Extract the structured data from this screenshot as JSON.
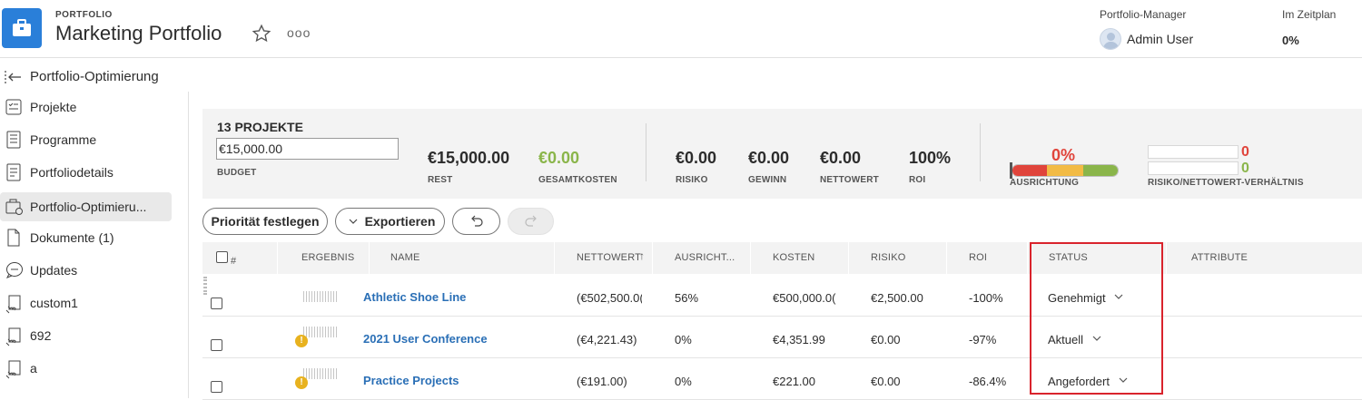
{
  "header": {
    "kicker": "PORTFOLIO",
    "title": "Marketing Portfolio",
    "star_icon": "★ outline",
    "more_icon": "ooo",
    "manager_label": "Portfolio-Manager",
    "manager_name": "Admin User",
    "schedule_label": "Im Zeitplan",
    "schedule_value": "0%"
  },
  "breadcrumb": {
    "label": "Portfolio-Optimierung"
  },
  "sidebar": {
    "items": [
      {
        "label": "Projekte",
        "icon": "projects-icon"
      },
      {
        "label": "Programme",
        "icon": "programs-icon"
      },
      {
        "label": "Portfoliodetails",
        "icon": "details-icon"
      },
      {
        "label": "Portfolio-Optimieru...",
        "icon": "optimizer-icon",
        "active": true
      },
      {
        "label": "Dokumente (1)",
        "icon": "document-icon"
      },
      {
        "label": "Updates",
        "icon": "updates-icon"
      },
      {
        "label": "custom1",
        "icon": "custom-icon"
      },
      {
        "label": "692",
        "icon": "custom-icon"
      },
      {
        "label": "a",
        "icon": "custom-icon"
      }
    ]
  },
  "summary": {
    "count": "13 PROJEKTE",
    "budget_value": "€15,000.00",
    "budget_label": "BUDGET",
    "rest_value": "€15,000.00",
    "rest_label": "REST",
    "total_cost_value": "€0.00",
    "total_cost_label": "GESAMTKOSTEN",
    "risk_value": "€0.00",
    "risk_label": "RISIKO",
    "profit_value": "€0.00",
    "profit_label": "GEWINN",
    "net_value": "€0.00",
    "net_label": "NETTOWERT",
    "roi_value": "100%",
    "roi_label": "ROI",
    "alignment_value": "0%",
    "alignment_label": "AUSRICHTUNG",
    "ratio_top": "0",
    "ratio_bottom": "0",
    "ratio_label": "RISIKO/NETTOWERT-VERHÄLTNIS"
  },
  "colors": {
    "red": "#e0443b",
    "yellow": "#f2bb45",
    "green": "#8ab54a",
    "link": "#2a6fb6",
    "highlight": "#d9232c"
  },
  "toolbar": {
    "priority_label": "Priorität festlegen",
    "export_label": "Exportieren",
    "undo_icon": "undo-icon",
    "redo_icon": "redo-icon"
  },
  "table": {
    "headers": {
      "number": "#",
      "result": "ERGEBNIS",
      "name": "NAME",
      "net": "NETTOWERT",
      "sort_icon": "↑",
      "alignment": "AUSRICHT...",
      "cost": "KOSTEN",
      "risk": "RISIKO",
      "roi": "ROI",
      "status": "STATUS",
      "attributes": "ATTRIBUTE"
    },
    "rows": [
      {
        "name": "Athletic Shoe Line",
        "net": "(€502,500.0(",
        "alignment": "56%",
        "cost": "€500,000.0(",
        "risk": "€2,500.00",
        "roi": "-100%",
        "status": "Genehmigt",
        "warning": false
      },
      {
        "name": "2021 User Conference",
        "net": "(€4,221.43)",
        "alignment": "0%",
        "cost": "€4,351.99",
        "risk": "€0.00",
        "roi": "-97%",
        "status": "Aktuell",
        "warning": true
      },
      {
        "name": "Practice Projects",
        "net": "(€191.00)",
        "alignment": "0%",
        "cost": "€221.00",
        "risk": "€0.00",
        "roi": "-86.4%",
        "status": "Angefordert",
        "warning": true
      }
    ]
  }
}
